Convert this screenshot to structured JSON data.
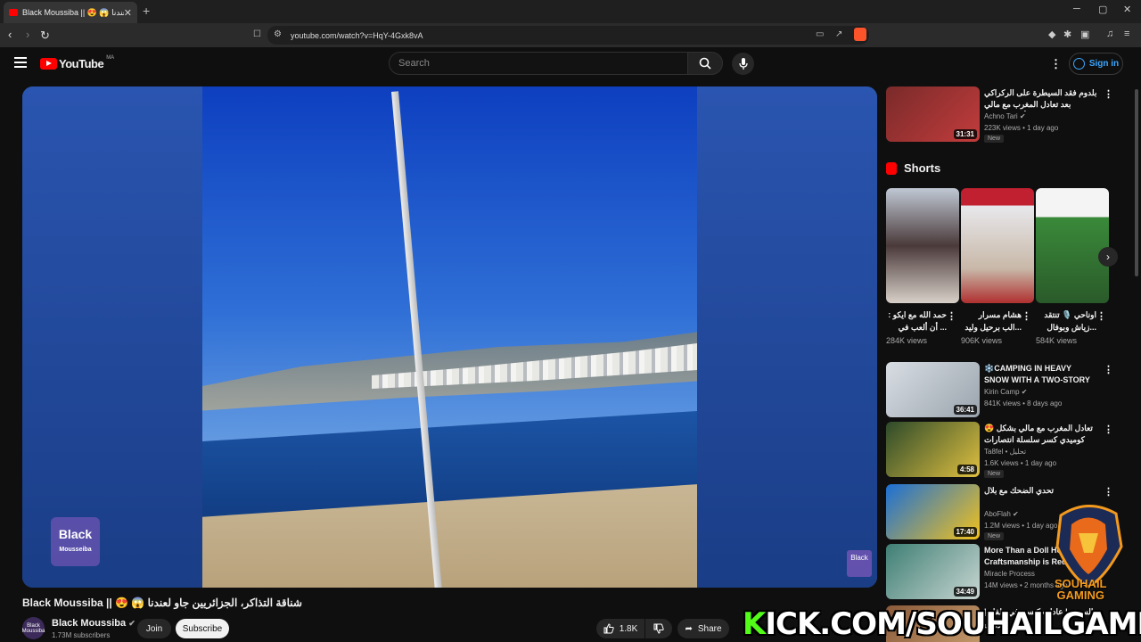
{
  "browser": {
    "tab_title": "Black Moussiba || 😍 😱 لعندنا",
    "new_tab": "+",
    "close": "✕",
    "url": "youtube.com/watch?v=HqY-4Gxk8vA",
    "win_min": "─",
    "win_max": "▢",
    "win_close": "✕"
  },
  "header": {
    "logo_text": "YouTube",
    "country_code": "MA",
    "search_placeholder": "Search",
    "signin_label": "Sign in"
  },
  "video": {
    "watermark_line1": "Black",
    "watermark_line2": "Mousseiba",
    "corner_mark": "Black",
    "title": "Black Moussiba || 😍 😱 شناقة التذاكر، الجزائريين جاو لعندنا",
    "channel_name": "Black Moussiba",
    "channel_avatar_text": "Black Moussiba",
    "subscribers": "1.73M subscribers",
    "join_label": "Join",
    "subscribe_label": "Subscribe",
    "likes": "1.8K",
    "share_label": "Share"
  },
  "overlay": {
    "kick_k": "K",
    "kick_rest": "ICK.COM/SOUHAILGAMING",
    "brand_line1": "SOUHAIL",
    "brand_line2": "GAMING"
  },
  "shorts_heading": "Shorts",
  "shorts": [
    {
      "title": "حمد الله مع ايكو : ... أن ألعب في",
      "views": "284K views"
    },
    {
      "title": "هشام مسرار ...الب برحيل وليد",
      "views": "906K views"
    },
    {
      "title": "اوناحي 🎙️ تنتقد ...زياش وبوفال في",
      "views": "584K views"
    }
  ],
  "recommendations": [
    {
      "title": "بلدوم فقد السيطرة على الركراكي بعد تعادل المغرب مع مالي ومخلاش أشنو قالو ليه",
      "channel": "Achno Tari",
      "meta": "223K views • 1 day ago",
      "badge": "New",
      "duration": "31:31",
      "colors": [
        "#7a2a2a",
        "#c23c3c"
      ]
    },
    {
      "title": "❄️CAMPING IN HEAVY SNOW WITH A TWO-STORY TENT",
      "channel": "Kirin Camp",
      "meta": "841K views • 8 days ago",
      "badge": "",
      "duration": "36:41",
      "colors": [
        "#d8dde3",
        "#9aa4ad"
      ]
    },
    {
      "title": "😍 تعادل المغرب مع مالي بشكل كوميدي كسر سلسلة انتصارات المغرب",
      "channel": "Ta8fel • تحليل",
      "meta": "1.6K views • 1 day ago",
      "badge": "New",
      "duration": "4:58",
      "colors": [
        "#2d4a2a",
        "#e0c040"
      ]
    },
    {
      "title": "تحدي الضحك مع بلال",
      "channel": "AboFlah",
      "meta": "1.2M views • 1 day ago",
      "badge": "New",
      "duration": "17:40",
      "colors": [
        "#1b6fd6",
        "#f3c21b"
      ]
    },
    {
      "title": "More Than a Doll How Craftsmanship is Redef",
      "channel": "Miracle Process",
      "meta": "14M views • 2 months ago",
      "badge": "",
      "duration": "34:49",
      "colors": [
        "#3e7f74",
        "#c9d6d2"
      ]
    },
    {
      "title": "السيتي | عادات كيسن في طفلو | دروس",
      "channel": "",
      "meta": "",
      "badge": "",
      "duration": "",
      "colors": [
        "#8a5a3a",
        "#c9a070"
      ]
    }
  ]
}
